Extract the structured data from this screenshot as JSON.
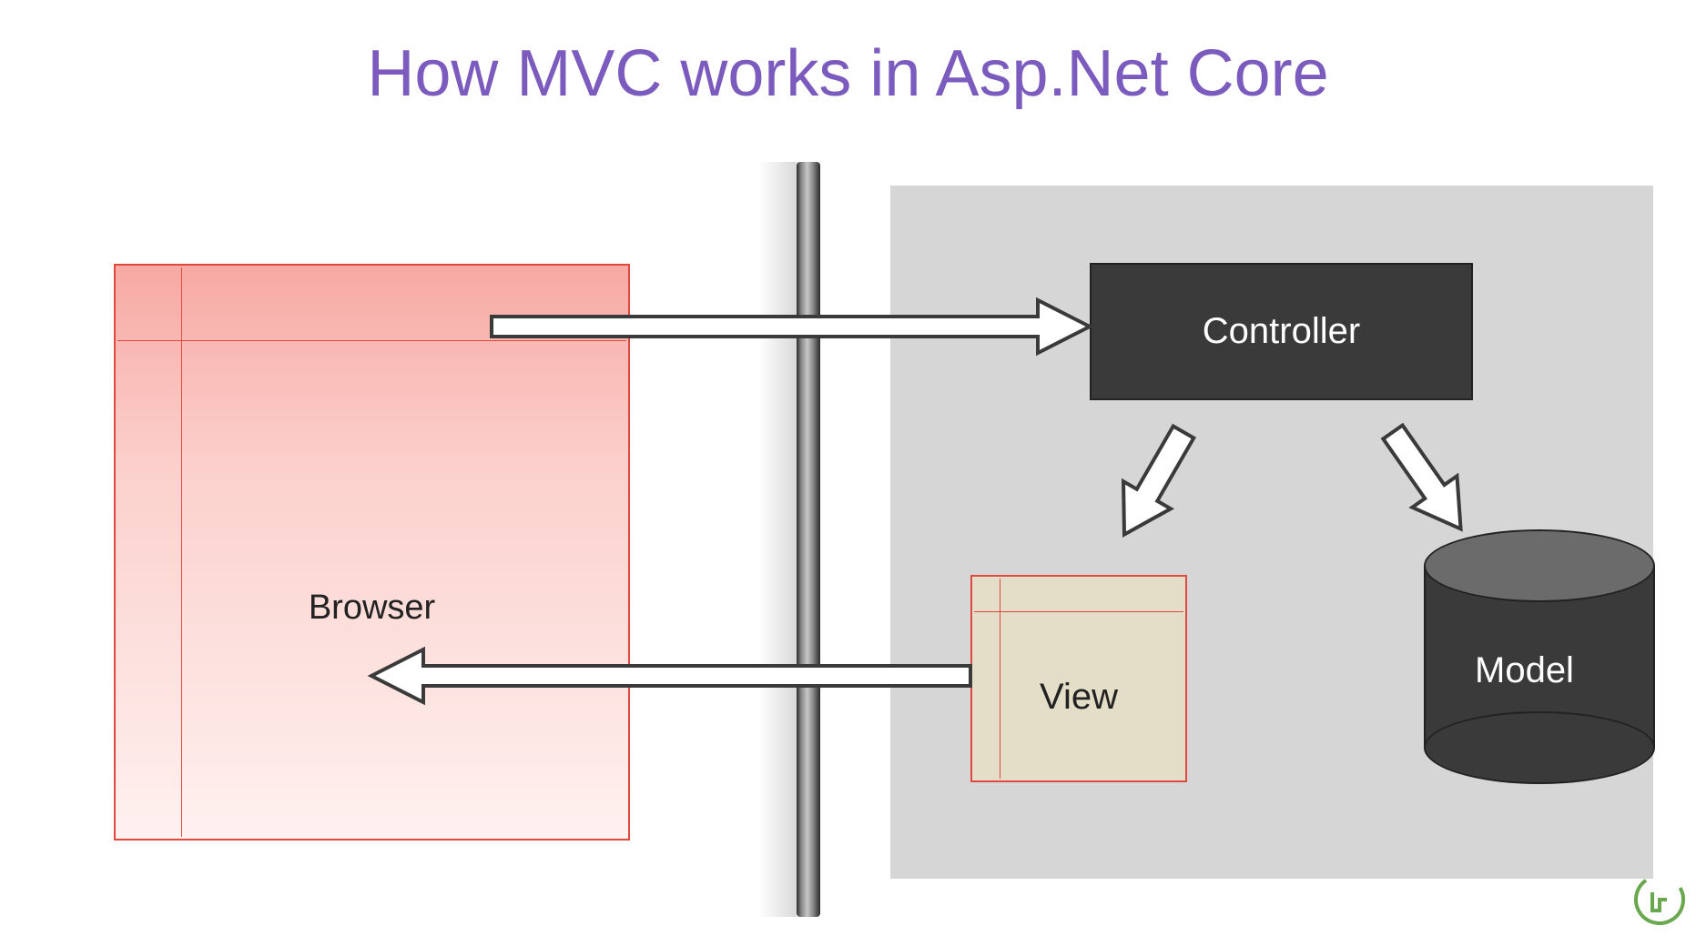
{
  "title": "How MVC works in Asp.Net Core",
  "nodes": {
    "browser": {
      "label": "Browser"
    },
    "controller": {
      "label": "Controller"
    },
    "view": {
      "label": "View"
    },
    "model": {
      "label": "Model"
    }
  },
  "arrows": [
    {
      "id": "browser-to-controller",
      "from": "browser",
      "to": "controller"
    },
    {
      "id": "controller-to-view",
      "from": "controller",
      "to": "view"
    },
    {
      "id": "controller-to-model",
      "from": "controller",
      "to": "model"
    },
    {
      "id": "view-to-browser",
      "from": "view",
      "to": "browser"
    }
  ],
  "colors": {
    "title": "#7c5bbf",
    "browser_border": "#e04a3e",
    "dark_fill": "#3a3a3a",
    "panel": "#d6d6d6",
    "view_fill": "#e4dec8"
  }
}
